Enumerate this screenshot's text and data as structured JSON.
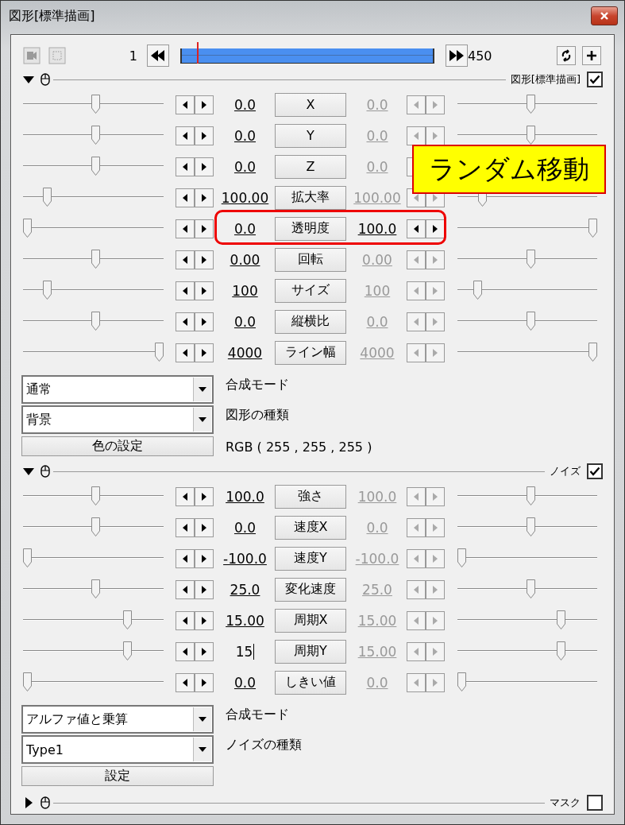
{
  "window": {
    "title": "図形[標準描画]"
  },
  "timeline": {
    "start": "1",
    "end": "450",
    "level": 0.06
  },
  "callout": "ランダム移動",
  "sections": [
    {
      "title": "図形[標準描画]",
      "expanded": true,
      "checked": true,
      "rows": [
        {
          "label": "X",
          "value": "0.0",
          "end_value": "0.0",
          "end_active": false,
          "left_slider": {
            "level": 0.52
          },
          "right_slider": {
            "level": 0.53
          },
          "highlighted": false,
          "editing": false
        },
        {
          "label": "Y",
          "value": "0.0",
          "end_value": "0.0",
          "end_active": false,
          "left_slider": {
            "level": 0.52
          },
          "right_slider": {
            "level": 0.53
          },
          "highlighted": false,
          "editing": false
        },
        {
          "label": "Z",
          "value": "0.0",
          "end_value": "0.0",
          "end_active": false,
          "left_slider": {
            "level": 0.52
          },
          "highlighted": false,
          "editing": false
        },
        {
          "label": "拡大率",
          "value": "100.00",
          "end_value": "100.00",
          "end_active": false,
          "left_slider": {
            "level": 0.15
          },
          "right_slider": {
            "level": 0.16
          },
          "highlighted": false,
          "editing": false
        },
        {
          "label": "透明度",
          "value": "0.0",
          "end_value": "100.0",
          "end_active": true,
          "left_slider": {
            "level": 0
          },
          "right_slider": {
            "level": 1
          },
          "highlighted": true,
          "editing": false
        },
        {
          "label": "回転",
          "value": "0.00",
          "end_value": "0.00",
          "end_active": false,
          "left_slider": {
            "level": 0.52
          },
          "right_slider": {
            "level": 0.53
          },
          "highlighted": false,
          "editing": false
        },
        {
          "label": "サイズ",
          "value": "100",
          "end_value": "100",
          "end_active": false,
          "left_slider": {
            "level": 0.15
          },
          "right_slider": {
            "level": 0.12
          },
          "highlighted": false,
          "editing": false
        },
        {
          "label": "縦横比",
          "value": "0.0",
          "end_value": "0.0",
          "end_active": false,
          "left_slider": {
            "level": 0.52
          },
          "right_slider": {
            "level": 0.53
          },
          "highlighted": false,
          "editing": false
        },
        {
          "label": "ライン幅",
          "value": "4000",
          "end_value": "4000",
          "end_active": false,
          "left_slider": {
            "level": 1
          },
          "right_slider": {
            "level": 1
          },
          "highlighted": false,
          "editing": false
        }
      ],
      "controls": [
        {
          "kind": "select",
          "value": "通常",
          "label": "合成モード"
        },
        {
          "kind": "select",
          "value": "背景",
          "label": "図形の種類"
        },
        {
          "kind": "button",
          "value": "色の設定",
          "label": "RGB ( 255 , 255 , 255 )"
        }
      ]
    },
    {
      "title": "ノイズ",
      "expanded": true,
      "checked": true,
      "rows": [
        {
          "label": "強さ",
          "value": "100.0",
          "end_value": "100.0",
          "end_active": false,
          "left_slider": {
            "level": 0.52
          },
          "right_slider": {
            "level": 0.53
          },
          "highlighted": false,
          "editing": false
        },
        {
          "label": "速度X",
          "value": "0.0",
          "end_value": "0.0",
          "end_active": false,
          "left_slider": {
            "level": 0.52
          },
          "right_slider": {
            "level": 0.53
          },
          "highlighted": false,
          "editing": false
        },
        {
          "label": "速度Y",
          "value": "-100.0",
          "end_value": "-100.0",
          "end_active": false,
          "left_slider": {
            "level": 0
          },
          "right_slider": {
            "level": 0
          },
          "highlighted": false,
          "editing": false
        },
        {
          "label": "変化速度",
          "value": "25.0",
          "end_value": "25.0",
          "end_active": false,
          "left_slider": {
            "level": 0.52
          },
          "right_slider": {
            "level": 0.53
          },
          "highlighted": false,
          "editing": false
        },
        {
          "label": "周期X",
          "value": "15.00",
          "end_value": "15.00",
          "end_active": false,
          "left_slider": {
            "level": 0.76
          },
          "right_slider": {
            "level": 0.76
          },
          "highlighted": false,
          "editing": false
        },
        {
          "label": "周期Y",
          "value": "15",
          "end_value": "15.00",
          "end_active": false,
          "left_slider": {
            "level": 0.76
          },
          "right_slider": {
            "level": 0.76
          },
          "highlighted": false,
          "editing": true
        },
        {
          "label": "しきい値",
          "value": "0.0",
          "end_value": "0.0",
          "end_active": false,
          "left_slider": {
            "level": 0
          },
          "right_slider": {
            "level": 0
          },
          "highlighted": false,
          "editing": false
        }
      ],
      "controls": [
        {
          "kind": "select",
          "value": "アルファ値と乗算",
          "label": "合成モード"
        },
        {
          "kind": "select",
          "value": "Type1",
          "label": "ノイズの種類"
        },
        {
          "kind": "button",
          "value": "設定"
        }
      ]
    },
    {
      "title": "マスク",
      "expanded": false,
      "checked": false
    }
  ]
}
